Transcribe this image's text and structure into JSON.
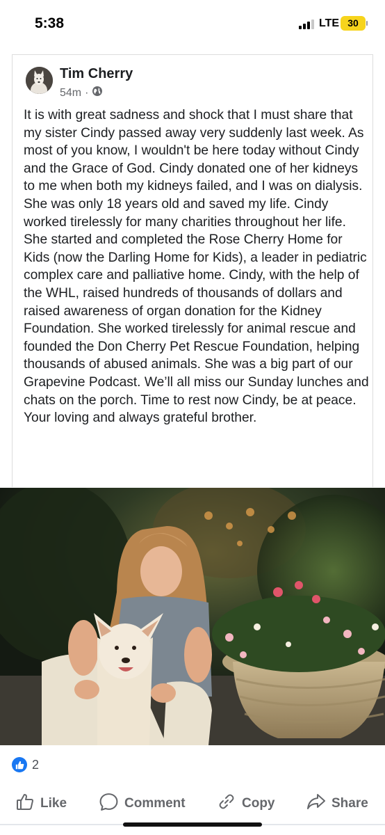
{
  "status_bar": {
    "time": "5:38",
    "network": "LTE",
    "battery": "30"
  },
  "post": {
    "author": "Tim Cherry",
    "timestamp": "54m",
    "audience_icon": "globe-icon",
    "text": "It is with great sadness and shock that I must share that my sister Cindy passed away very suddenly last week. As most of you know, I wouldn't be here today without Cindy and the Grace of God. Cindy donated one of her kidneys to me when both my kidneys failed, and I was on dialysis. She was only 18 years old and saved my life. Cindy worked tirelessly for many charities throughout her life. She started and completed the Rose Cherry Home for Kids (now the Darling Home for Kids), a leader in pediatric complex care and palliative home. Cindy, with the help of the WHL, raised hundreds of thousands of dollars and raised awareness of organ donation for the Kidney Foundation. She worked tirelessly for animal rescue and founded the Don Cherry Pet Rescue Foundation, helping thousands of abused animals. She was a big part of our Grapevine Podcast. We’ll all miss our Sunday lunches and chats on the porch. Time to rest now Cindy, be at peace. Your loving and always grateful brother."
  },
  "reactions": {
    "icon": "like-icon",
    "count": "2"
  },
  "actions": {
    "like": "Like",
    "comment": "Comment",
    "copy": "Copy",
    "share": "Share"
  },
  "colors": {
    "accent": "#1877f2",
    "battery": "#f7d41c",
    "secondary_text": "#65676b"
  }
}
